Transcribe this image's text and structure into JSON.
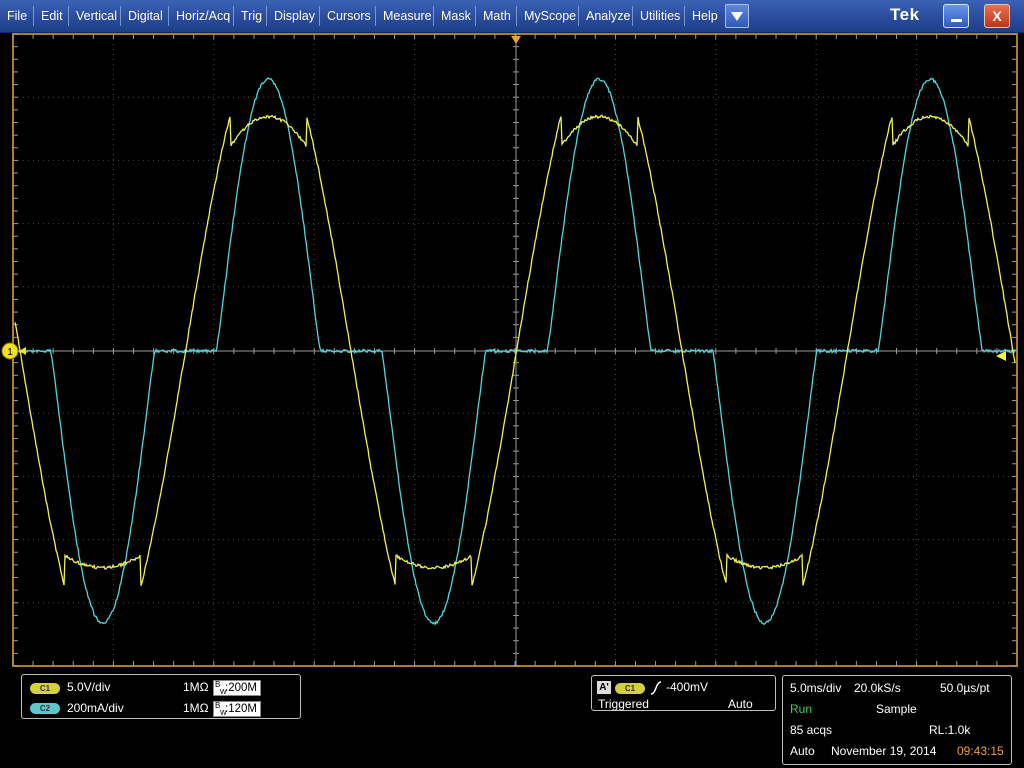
{
  "menubar": {
    "items": [
      "File",
      "Edit",
      "Vertical",
      "Digital",
      "Horiz/Acq",
      "Trig",
      "Display",
      "Cursors",
      "Measure",
      "Mask",
      "Math",
      "MyScope",
      "Analyze",
      "Utilities",
      "Help"
    ],
    "logo": "Tek",
    "dropdown_icon": "triangle-down-icon",
    "minimize_icon": "minimize-icon",
    "close_label": "X"
  },
  "colors": {
    "background": "#000000",
    "grid": "#4a4a4a",
    "frame": "#b07a2e",
    "ch1": "#f2f24b",
    "ch2": "#4fd7de",
    "menubar": "#2a4c9c"
  },
  "waveform": {
    "ch1_marker": "1",
    "trigger_level_marker": "triangle-left-icon",
    "trigger_position_marker": "triangle-down-icon"
  },
  "channels": [
    {
      "badge": "C1",
      "scale": "5.0V/div",
      "impedance": "1MΩ",
      "bw_prefix": "B",
      "bw_sub": "W",
      "bw": ":200M"
    },
    {
      "badge": "C2",
      "scale": "200mA/div",
      "impedance": "1MΩ",
      "bw_prefix": "B",
      "bw_sub": "W",
      "bw": ":120M"
    }
  ],
  "trigger": {
    "badge_a": "A'",
    "badge_ch": "C1",
    "slope_icon": "rising-edge-icon",
    "level": "-400mV",
    "state": "Triggered",
    "mode": "Auto"
  },
  "horizontal": {
    "scale": "5.0ms/div",
    "rate": "20.0kS/s",
    "resolution": "50.0µs/pt",
    "status": "Run",
    "mode": "Sample",
    "acqs": "85 acqs",
    "record_length": "RL:1.0k",
    "trigger_mode": "Auto",
    "date": "November 19, 2014",
    "time": "09:43:15"
  }
}
